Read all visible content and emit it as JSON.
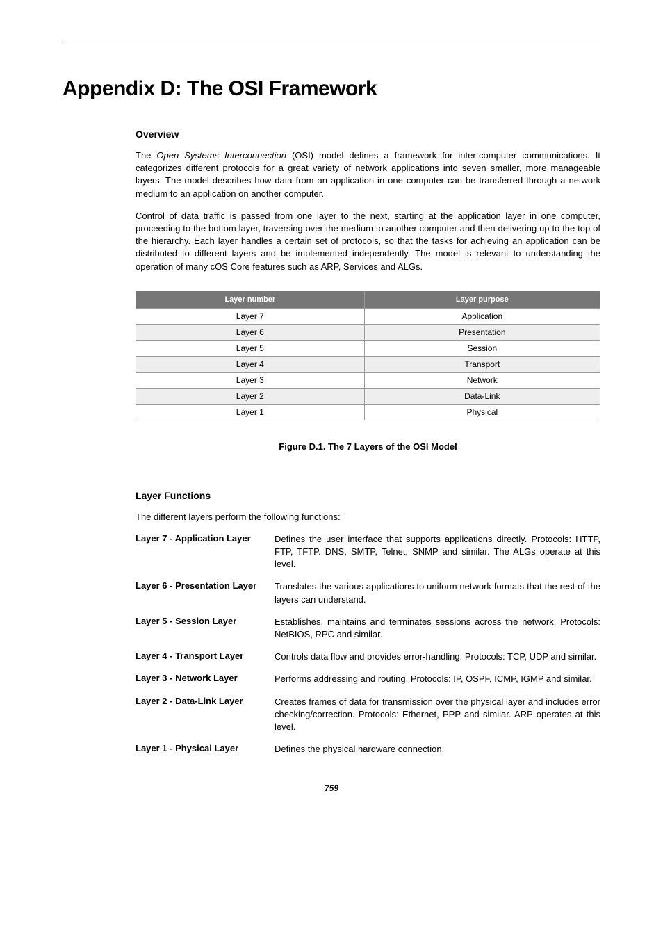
{
  "title": "Appendix D: The OSI Framework",
  "sections": {
    "overview": {
      "heading": "Overview",
      "para1_prefix": "The ",
      "para1_italic": "Open Systems Interconnection",
      "para1_suffix": " (OSI) model defines a framework for inter-computer communications. It categorizes different protocols for a great variety of network applications into seven smaller, more manageable layers. The model describes how data from an application in one computer can be transferred through a network medium to an application on another computer.",
      "para2": "Control of data traffic is passed from one layer to the next, starting at the application layer in one computer, proceeding to the bottom layer, traversing over the medium to another computer and then delivering up to the top of the hierarchy. Each layer handles a certain set of protocols, so that the tasks for achieving an application can be distributed to different layers and be implemented independently. The model is relevant to understanding the operation of many cOS Core features such as ARP, Services and ALGs."
    },
    "table": {
      "headers": [
        "Layer number",
        "Layer purpose"
      ],
      "rows": [
        [
          "Layer 7",
          "Application"
        ],
        [
          "Layer 6",
          "Presentation"
        ],
        [
          "Layer 5",
          "Session"
        ],
        [
          "Layer 4",
          "Transport"
        ],
        [
          "Layer 3",
          "Network"
        ],
        [
          "Layer 2",
          "Data-Link"
        ],
        [
          "Layer 1",
          "Physical"
        ]
      ]
    },
    "figure_caption": "Figure D.1. The 7 Layers of the OSI Model",
    "functions": {
      "heading": "Layer Functions",
      "intro": "The different layers perform the following functions:",
      "layers": [
        {
          "label": "Layer 7 - Application Layer",
          "desc": "Defines the user interface that supports applications directly. Protocols: HTTP, FTP, TFTP. DNS, SMTP, Telnet, SNMP and similar. The ALGs operate at this level."
        },
        {
          "label": "Layer 6 - Presentation Layer",
          "desc": "Translates the various applications to uniform network formats that the rest of the layers can understand."
        },
        {
          "label": "Layer 5 - Session Layer",
          "desc": "Establishes, maintains and terminates sessions across the network. Protocols: NetBIOS, RPC and similar."
        },
        {
          "label": "Layer 4 - Transport Layer",
          "desc": "Controls data flow and provides error-handling. Protocols: TCP, UDP and similar."
        },
        {
          "label": "Layer 3 - Network Layer",
          "desc": "Performs addressing and routing. Protocols: IP, OSPF, ICMP, IGMP and similar."
        },
        {
          "label": "Layer 2 - Data-Link Layer",
          "desc": "Creates frames of data for transmission over the physical layer and includes error checking/correction. Protocols: Ethernet, PPP and similar. ARP operates at this level."
        },
        {
          "label": "Layer 1 - Physical Layer",
          "desc": "Defines the physical hardware connection."
        }
      ]
    }
  },
  "page_number": "759",
  "chart_data": {
    "type": "table",
    "title": "Figure D.1. The 7 Layers of the OSI Model",
    "columns": [
      "Layer number",
      "Layer purpose"
    ],
    "rows": [
      [
        "Layer 7",
        "Application"
      ],
      [
        "Layer 6",
        "Presentation"
      ],
      [
        "Layer 5",
        "Session"
      ],
      [
        "Layer 4",
        "Transport"
      ],
      [
        "Layer 3",
        "Network"
      ],
      [
        "Layer 2",
        "Data-Link"
      ],
      [
        "Layer 1",
        "Physical"
      ]
    ]
  }
}
